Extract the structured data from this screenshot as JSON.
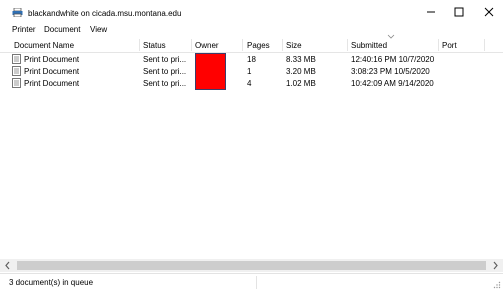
{
  "window": {
    "title": "blackandwhite on cicada.msu.montana.edu",
    "icon": "printer-icon"
  },
  "menu": [
    "Printer",
    "Document",
    "View"
  ],
  "columns": [
    "Document Name",
    "Status",
    "Owner",
    "Pages",
    "Size",
    "Submitted",
    "Port"
  ],
  "rows": [
    {
      "name": "Print Document",
      "status": "Sent to pri...",
      "owner": "",
      "pages": "18",
      "size": "8.33 MB",
      "submitted": "12:40:16 PM  10/7/2020",
      "port": ""
    },
    {
      "name": "Print Document",
      "status": "Sent to pri...",
      "owner": "",
      "pages": "1",
      "size": "3.20 MB",
      "submitted": "3:08:23 PM  10/5/2020",
      "port": ""
    },
    {
      "name": "Print Document",
      "status": "Sent to pri...",
      "owner": "",
      "pages": "4",
      "size": "1.02 MB",
      "submitted": "10:42:09 AM  9/14/2020",
      "port": ""
    }
  ],
  "status": {
    "text": "3 document(s) in queue"
  },
  "colors": {
    "redaction": "#ff0000"
  }
}
